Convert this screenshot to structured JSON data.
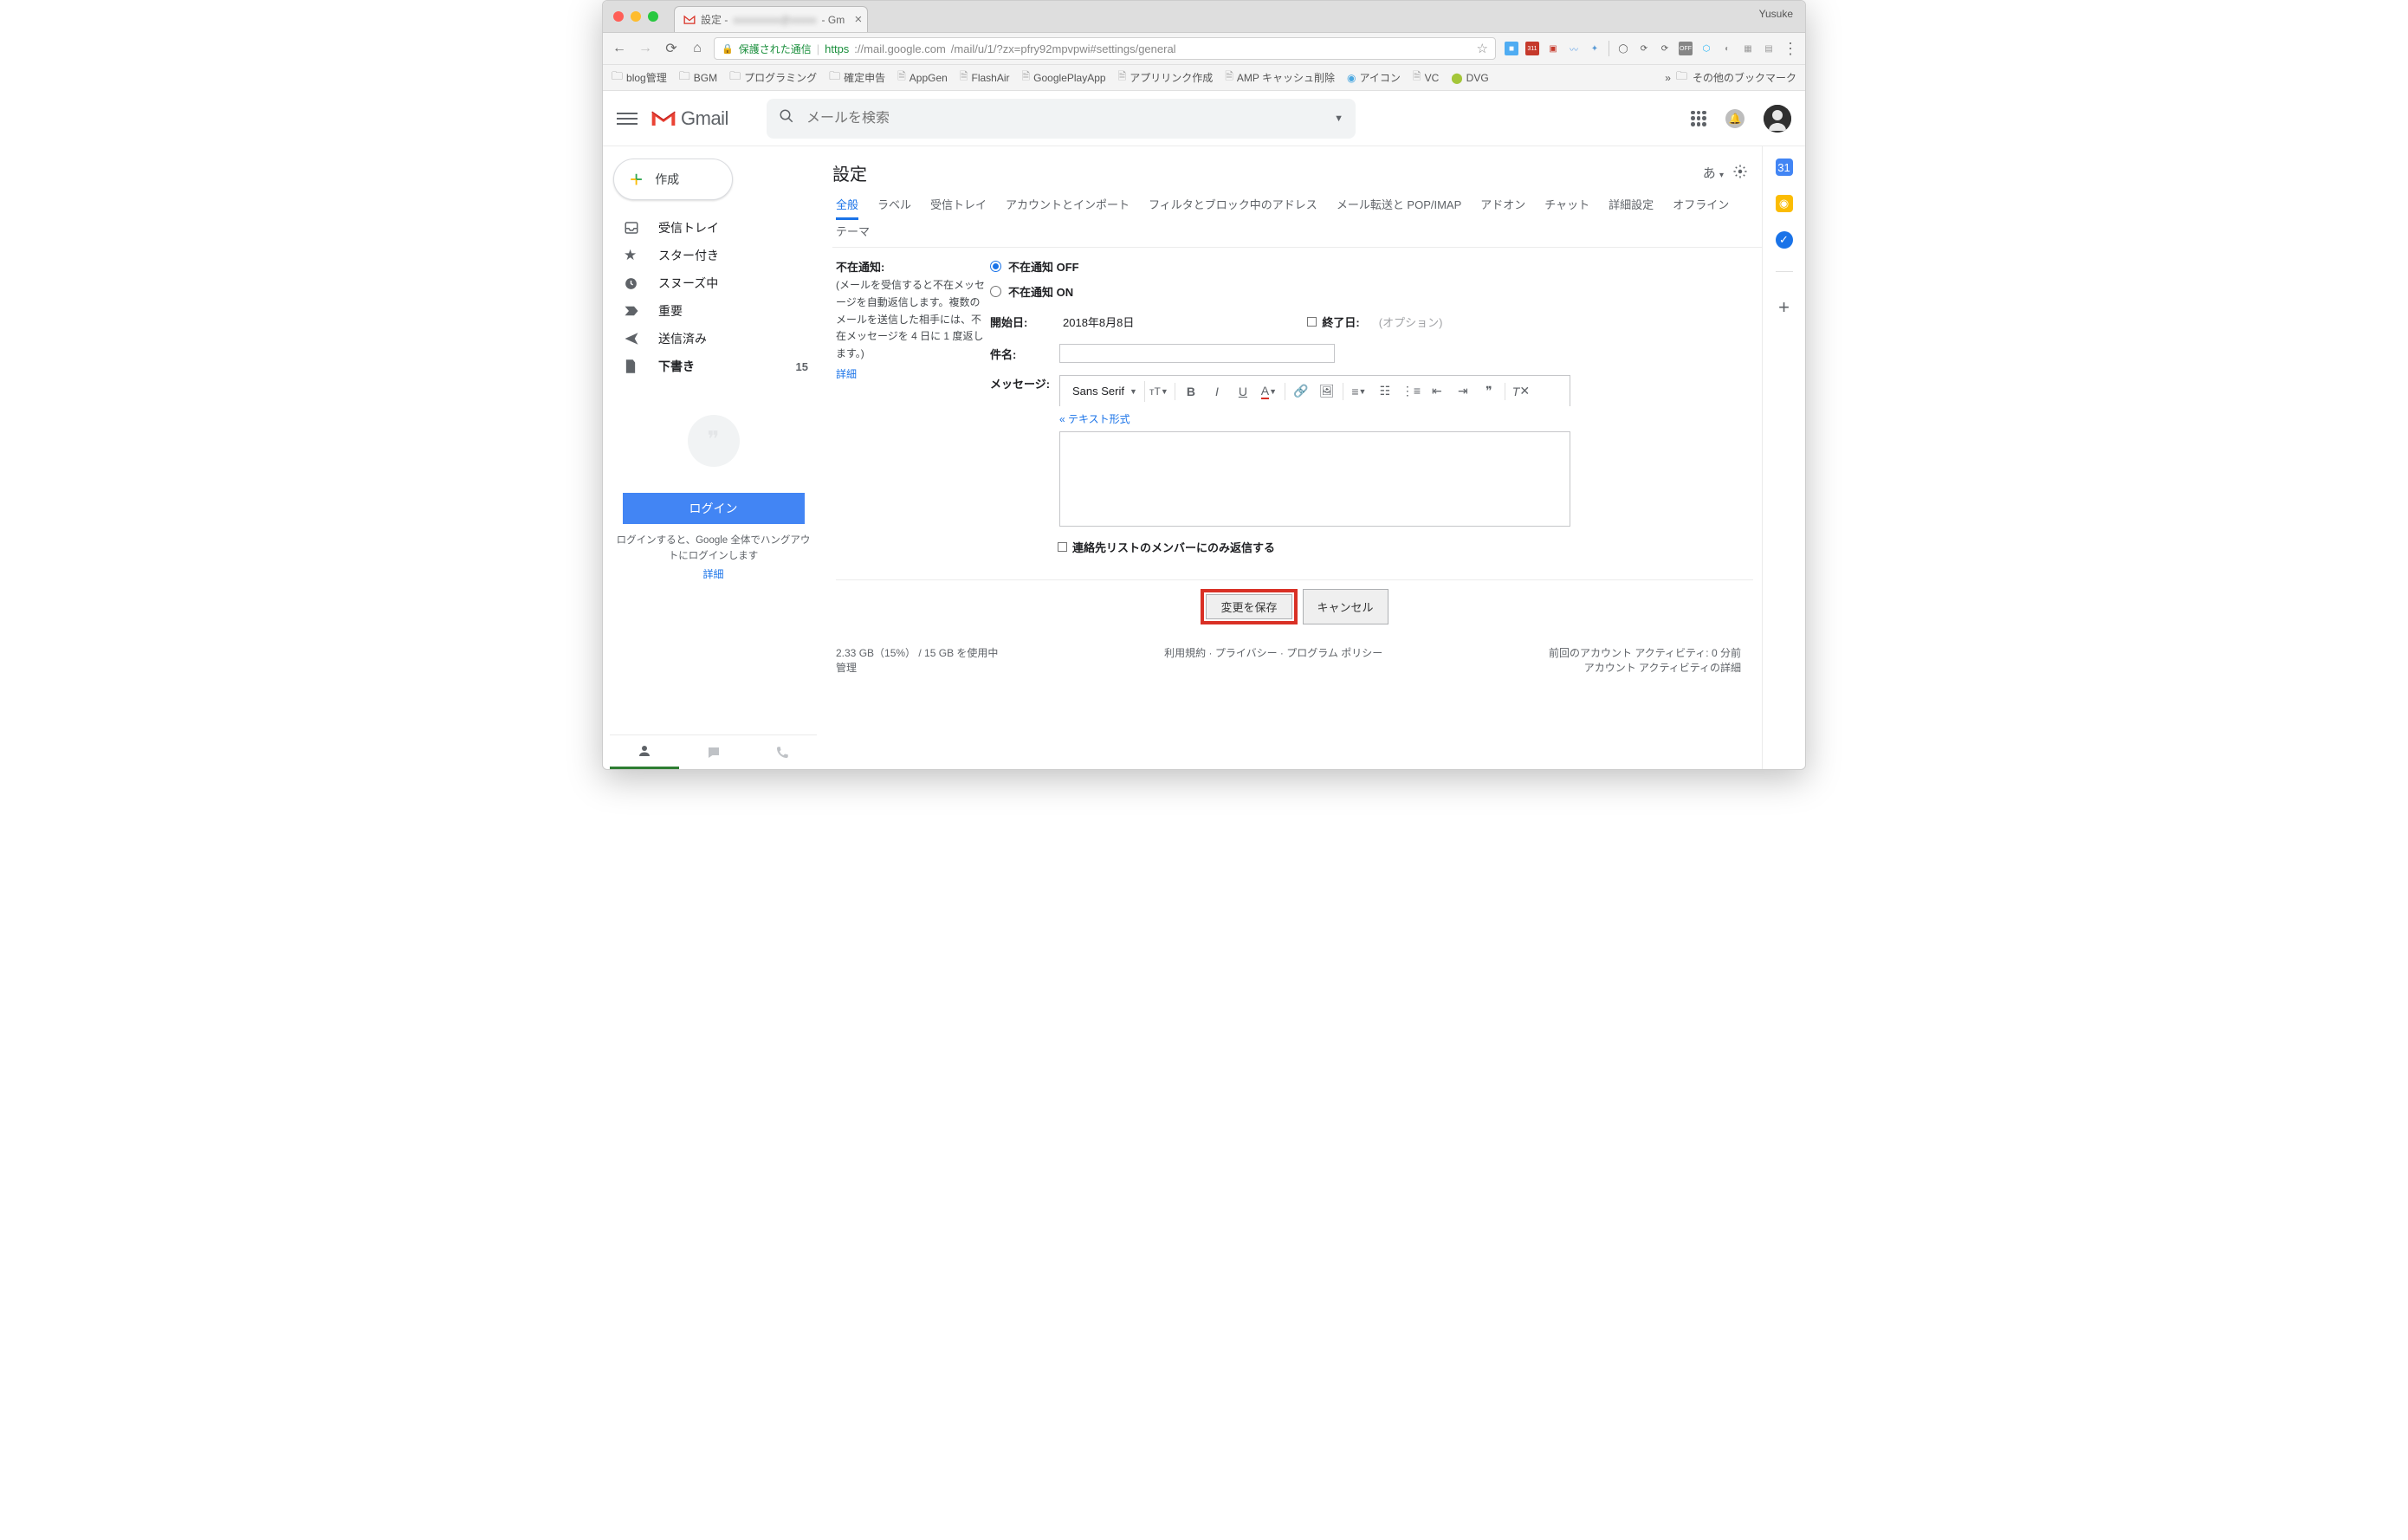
{
  "browser": {
    "profile_name": "Yusuke",
    "tab_title_prefix": "設定 - ",
    "tab_title_suffix": " - Gm",
    "secure_label": "保護された通信",
    "url_scheme": "https",
    "url_host": "://mail.google.com",
    "url_path": "/mail/u/1/?zx=pfry92mpvpwi#settings/general"
  },
  "bookmarks": {
    "items": [
      {
        "label": "blog管理",
        "type": "folder"
      },
      {
        "label": "BGM",
        "type": "folder"
      },
      {
        "label": "プログラミング",
        "type": "folder"
      },
      {
        "label": "確定申告",
        "type": "folder"
      },
      {
        "label": "AppGen",
        "type": "page"
      },
      {
        "label": "FlashAir",
        "type": "page"
      },
      {
        "label": "GooglePlayApp",
        "type": "page"
      },
      {
        "label": "アプリリンク作成",
        "type": "page"
      },
      {
        "label": "AMP キャッシュ削除",
        "type": "page"
      },
      {
        "label": "アイコン",
        "type": "icon"
      },
      {
        "label": "VC",
        "type": "page"
      },
      {
        "label": "DVG",
        "type": "android"
      }
    ],
    "overflow": "»",
    "other": "その他のブックマーク"
  },
  "gmail": {
    "logo_text": "Gmail",
    "search_placeholder": "メールを検索",
    "compose": "作成",
    "nav": [
      {
        "label": "受信トレイ",
        "ico": "inbox",
        "bold": false
      },
      {
        "label": "スター付き",
        "ico": "star",
        "bold": false
      },
      {
        "label": "スヌーズ中",
        "ico": "clock",
        "bold": false
      },
      {
        "label": "重要",
        "ico": "important",
        "bold": false
      },
      {
        "label": "送信済み",
        "ico": "send",
        "bold": false
      },
      {
        "label": "下書き",
        "ico": "draft",
        "bold": true,
        "count": "15"
      }
    ],
    "hangouts_login_btn": "ログイン",
    "hangouts_note": "ログインすると、Google 全体でハングアウトにログインします",
    "hangouts_detail": "詳細"
  },
  "settings": {
    "title": "設定",
    "lang_icon": "あ",
    "tabs": [
      {
        "label": "全般",
        "active": true
      },
      {
        "label": "ラベル"
      },
      {
        "label": "受信トレイ"
      },
      {
        "label": "アカウントとインポート"
      },
      {
        "label": "フィルタとブロック中のアドレス"
      },
      {
        "label": "メール転送と POP/IMAP"
      },
      {
        "label": "アドオン"
      },
      {
        "label": "チャット"
      },
      {
        "label": "詳細設定"
      },
      {
        "label": "オフライン"
      },
      {
        "label": "テーマ"
      }
    ],
    "section_label": "不在通知:",
    "section_desc": "(メールを受信すると不在メッセージを自動返信します。複数のメールを送信した相手には、不在メッセージを 4 日に 1 度返します。)",
    "section_detail": "詳細",
    "radio_off": "不在通知 OFF",
    "radio_on": "不在通知 ON",
    "start_label": "開始日:",
    "start_value": "2018年8月8日",
    "end_label": "終了日:",
    "end_optional": "(オプション)",
    "subject_label": "件名:",
    "message_label": "メッセージ:",
    "font_name": "Sans Serif",
    "plain_link": "« テキスト形式",
    "contacts_only": "連絡先リストのメンバーにのみ返信する",
    "save_btn": "変更を保存",
    "cancel_btn": "キャンセル"
  },
  "footer": {
    "storage": "2.33 GB（15%） / 15 GB を使用中",
    "manage": "管理",
    "center": "利用規約 · プライバシー · プログラム ポリシー",
    "activity_last": "前回のアカウント アクティビティ: 0 分前",
    "activity_detail": "アカウント アクティビティの詳細"
  }
}
